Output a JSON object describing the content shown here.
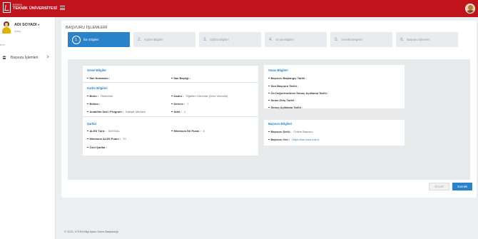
{
  "topbar": {
    "logo_small": "KONYA",
    "logo_big": "TEKNİK ÜNİVERSİTESİ",
    "accent_color": "#c0141d"
  },
  "sidebar": {
    "user_name": "ADI SOYADI",
    "user_role": "Aday",
    "section_label": "enu",
    "items": [
      {
        "label": "Başvuru İşlemleri",
        "icon": "home-icon"
      }
    ]
  },
  "main": {
    "title": "BAŞVURU İŞLEMLERİ",
    "steps": [
      {
        "num": "1.",
        "label": "İlan Bilgileri",
        "active": true
      },
      {
        "num": "2.",
        "label": "Kişisel Bilgiler",
        "active": false
      },
      {
        "num": "3.",
        "label": "Eğitim Bilgileri",
        "active": false
      },
      {
        "num": "4.",
        "label": "Sınav Bilgileri",
        "active": false
      },
      {
        "num": "5.",
        "label": "Gerekli Belgeler",
        "active": false
      },
      {
        "num": "6.",
        "label": "Başvuru İşlemleri",
        "active": false
      }
    ],
    "genel": {
      "title": "Genel Bilgiler",
      "ilan_numarasi": "İlan Numarası :",
      "ilan_basligi": "İlan Başlığı :"
    },
    "kadro": {
      "title": "Kadro Bilgileri",
      "birim_label": "Birim :",
      "birim_value": "Rektörlük",
      "kadro_label": "Kadro :",
      "kadro_value": "Öğretim Görevlisi (Ders Verecek)",
      "bolum_label": "Bölüm :",
      "derece_label": "Derece :",
      "derece_value": "7",
      "anabilim_label": "Anabilim Dalı / Program :",
      "anabilim_value": "Kariyer Merkezi",
      "adet_label": "Adet :",
      "adet_value": "1"
    },
    "sartlar": {
      "title": "Şartlar",
      "ales_turu_label": "ALES Türü :",
      "ales_turu_value": "SAYISAL",
      "min_dil_label": "Minimum Dil Puanı :",
      "min_dil_value": "0",
      "min_ales_label": "Minimum ALES Puanı :",
      "min_ales_value": "70",
      "ozel_label": "Özel Şartlar :"
    },
    "sinav": {
      "title": "Sınav Bilgileri",
      "basvuru_baslangic": "Başvuru Başlangıç Tarihi :",
      "son_basvuru": "Son Başvuru Tarihi :",
      "on_degerlendirme": "Ön Değerlendirme Sonuç Açıklama Tarihi :",
      "sinav_giris": "Sınav Giriş Tarihi :",
      "sonuc_aciklama": "Sonuç Açıklama Tarihi :"
    },
    "basvuru": {
      "title": "Başvuru Bilgileri",
      "sekil_label": "Başvuru Şekli :",
      "sekil_value": "Online Başvuru",
      "yeri_label": "Başvuru Yeri :",
      "yeri_value": "https://ilan.ktun.edu.tr"
    },
    "prev_label": "Önceki",
    "next_label": "Sonraki"
  },
  "footer": {
    "text": "© 2021. KTÜN Bilgi İşlem Daire Başkanlığı"
  }
}
